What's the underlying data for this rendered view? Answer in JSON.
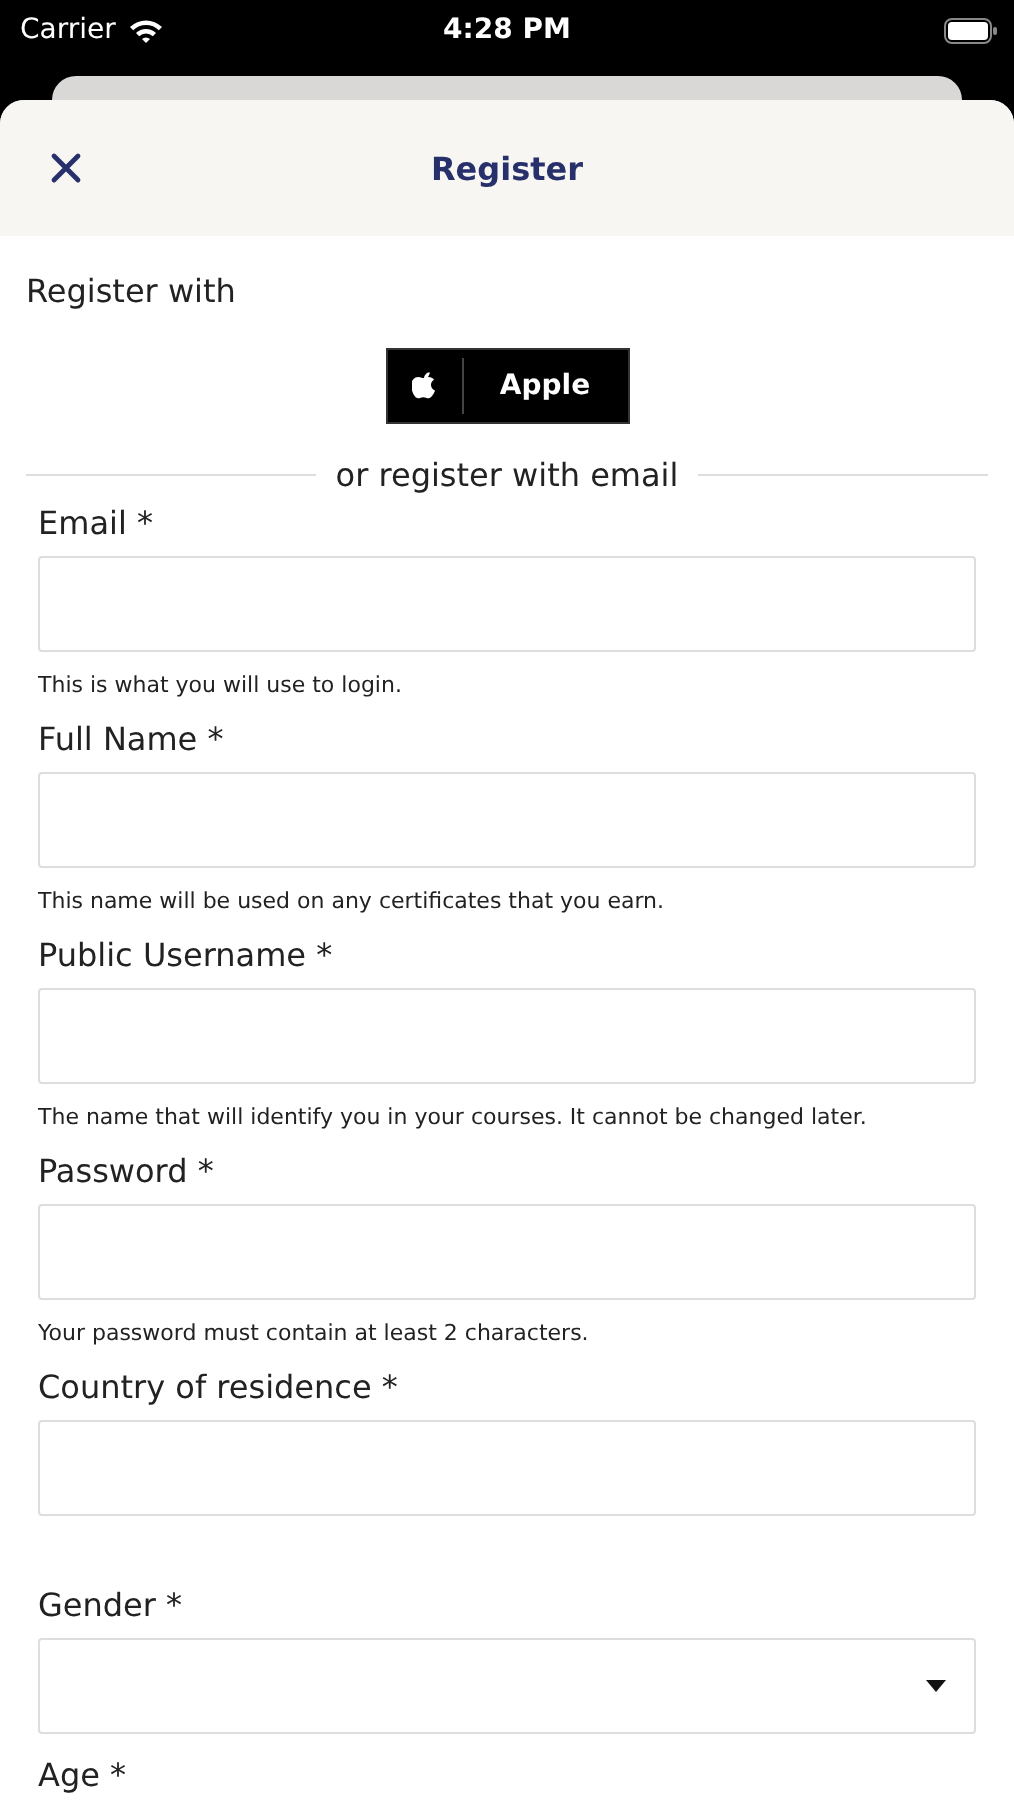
{
  "status_bar": {
    "carrier": "Carrier",
    "time": "4:28 PM"
  },
  "header": {
    "title": "Register"
  },
  "register_with": {
    "label": "Register with",
    "buttons": [
      {
        "label": "Apple"
      }
    ]
  },
  "divider_text": "or register with email",
  "fields": [
    {
      "kind": "text",
      "label": "Email *",
      "hint": "This is what you will use to login."
    },
    {
      "kind": "text",
      "label": "Full Name *",
      "hint": "This name will be used on any certificates that you earn."
    },
    {
      "kind": "text",
      "label": "Public Username *",
      "hint": "The name that will identify you in your courses. It cannot be changed later."
    },
    {
      "kind": "password",
      "label": "Password *",
      "hint": "Your password must contain at least 2 characters."
    },
    {
      "kind": "text",
      "label": "Country of residence *"
    },
    {
      "kind": "select",
      "label": "Gender *"
    },
    {
      "kind": "text",
      "label": "Age *"
    }
  ]
}
